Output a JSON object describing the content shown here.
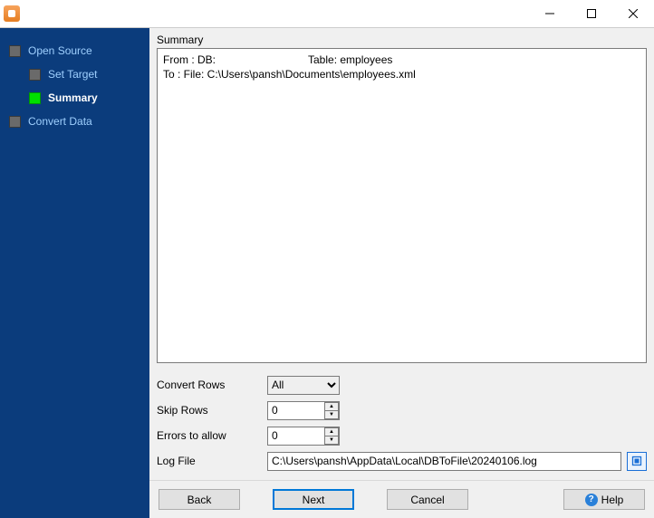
{
  "window": {
    "title": ""
  },
  "sidebar": {
    "items": [
      {
        "label": "Open Source",
        "child": false,
        "active": false
      },
      {
        "label": "Set Target",
        "child": true,
        "active": false
      },
      {
        "label": "Summary",
        "child": true,
        "active": true
      },
      {
        "label": "Convert Data",
        "child": false,
        "active": false
      }
    ]
  },
  "summary": {
    "title": "Summary",
    "from_db_label": "From : DB:",
    "from_table_label": "Table: employees",
    "to_label": "To : File: C:\\Users\\pansh\\Documents\\employees.xml"
  },
  "options": {
    "convert_rows_label": "Convert Rows",
    "convert_rows_value": "All",
    "skip_rows_label": "Skip Rows",
    "skip_rows_value": "0",
    "errors_label": "Errors to allow",
    "errors_value": "0",
    "log_label": "Log File",
    "log_value": "C:\\Users\\pansh\\AppData\\Local\\DBToFile\\20240106.log"
  },
  "buttons": {
    "back": "Back",
    "next": "Next",
    "cancel": "Cancel",
    "help": "Help"
  }
}
